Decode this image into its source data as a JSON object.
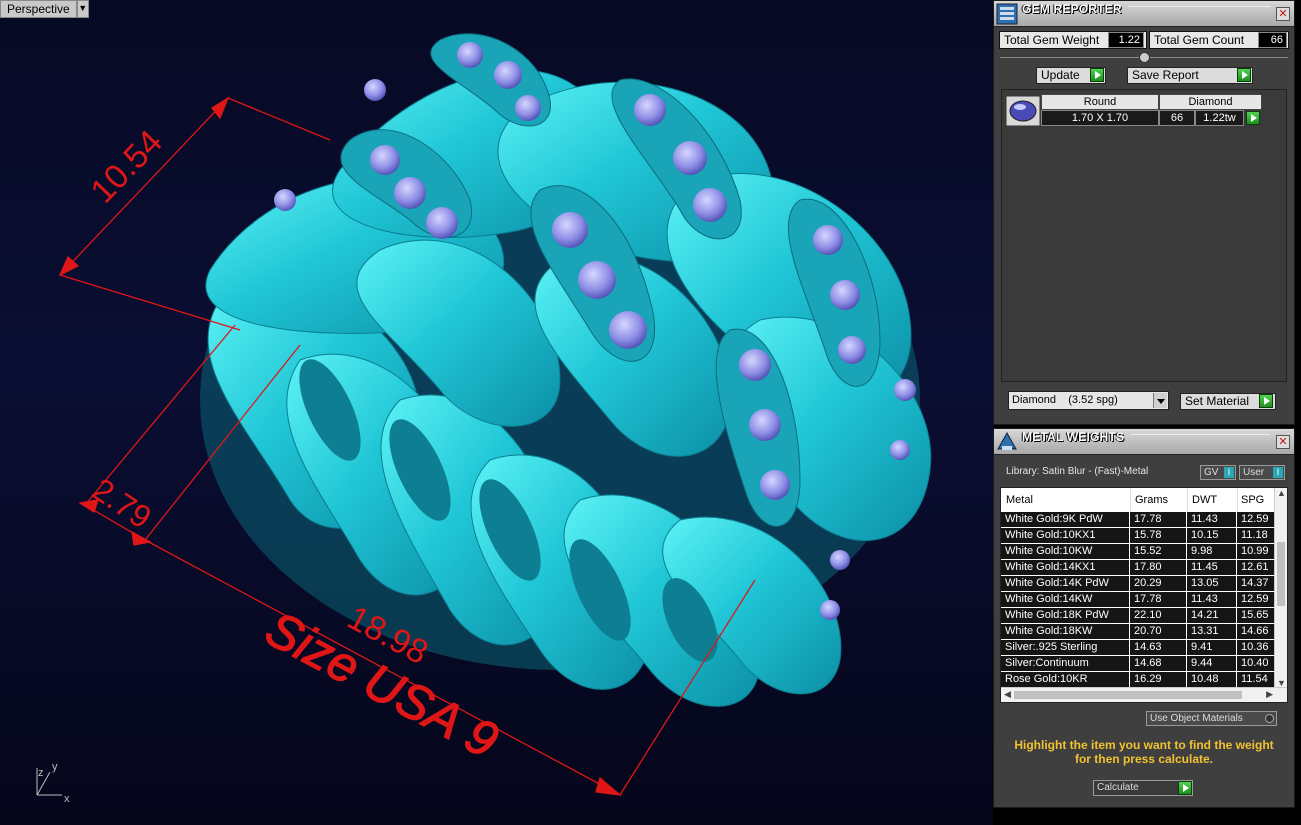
{
  "viewport": {
    "label": "Perspective",
    "dimensions": {
      "height_label": "10.54",
      "width_label": "2.79",
      "diameter_label": "18.98",
      "size_label": "Size USA 9"
    },
    "axes": {
      "x": "x",
      "y": "y",
      "z": "z"
    }
  },
  "gem_reporter": {
    "title": "GEM REPORTER",
    "close": "✕",
    "total_weight_label": "Total Gem Weight",
    "total_weight_value": "1.22",
    "total_count_label": "Total Gem Count",
    "total_count_value": "66",
    "update_label": "Update",
    "save_report_label": "Save Report",
    "gem": {
      "shape": "Round",
      "material": "Diamond",
      "size": "1.70 X 1.70",
      "count": "66",
      "weight": "1.22tw"
    },
    "material_select": "Diamond    (3.52 spg)",
    "set_material_label": "Set Material"
  },
  "metal_weights": {
    "title": "METAL WEIGHTS",
    "close": "✕",
    "library": "Library: Satin Blur - (Fast)-Metal",
    "gv_label": "GV",
    "user_label": "User",
    "columns": [
      "Metal",
      "Grams",
      "DWT",
      "SPG"
    ],
    "rows": [
      [
        "White Gold:9K PdW",
        "17.78",
        "11.43",
        "12.59"
      ],
      [
        "White Gold:10KX1",
        "15.78",
        "10.15",
        "11.18"
      ],
      [
        "White Gold:10KW",
        "15.52",
        "9.98",
        "10.99"
      ],
      [
        "White Gold:14KX1",
        "17.80",
        "11.45",
        "12.61"
      ],
      [
        "White Gold:14K PdW",
        "20.29",
        "13.05",
        "14.37"
      ],
      [
        "White Gold:14KW",
        "17.78",
        "11.43",
        "12.59"
      ],
      [
        "White Gold:18K PdW",
        "22.10",
        "14.21",
        "15.65"
      ],
      [
        "White Gold:18KW",
        "20.70",
        "13.31",
        "14.66"
      ],
      [
        "Silver:.925 Sterling",
        "14.63",
        "9.41",
        "10.36"
      ],
      [
        "Silver:Continuum",
        "14.68",
        "9.44",
        "10.40"
      ],
      [
        "Rose Gold:10KR",
        "16.29",
        "10.48",
        "11.54"
      ]
    ],
    "use_object_materials": "Use Object Materials",
    "hint_line1": "Highlight the item you want to find the weight",
    "hint_line2": "for then press calculate.",
    "calculate_label": "Calculate"
  },
  "colors": {
    "ring": "#2ad3df",
    "gem": "#8f8fe0",
    "dimension": "#e01616",
    "panel_bg": "#3f3f3f"
  }
}
